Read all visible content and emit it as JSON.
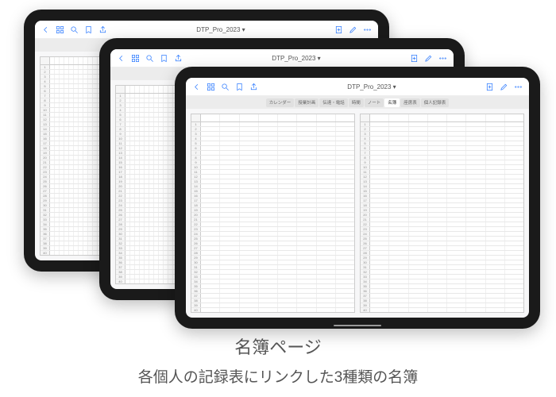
{
  "doc_title": "DTP_Pro_2023 ▾",
  "tabs": [
    {
      "label": "カレンダー",
      "active": false
    },
    {
      "label": "授業計画",
      "active": false
    },
    {
      "label": "伝達・電話",
      "active": false
    },
    {
      "label": "時間",
      "active": false
    },
    {
      "label": "ノート",
      "active": false
    },
    {
      "label": "名簿",
      "active": true
    },
    {
      "label": "座席表",
      "active": false
    },
    {
      "label": "個人記録表",
      "active": false
    }
  ],
  "roster": {
    "rows": 40,
    "wide_cols": 8,
    "narrow_cols": 30
  },
  "caption_title": "名簿ページ",
  "caption_sub": "各個人の記録表にリンクした3種類の名簿",
  "icons": {
    "back": "chevron-left",
    "thumbnails": "grid",
    "search": "magnifier",
    "bookmark": "bookmark",
    "share": "share",
    "add_page": "page-plus",
    "edit": "pencil",
    "more": "dots"
  }
}
